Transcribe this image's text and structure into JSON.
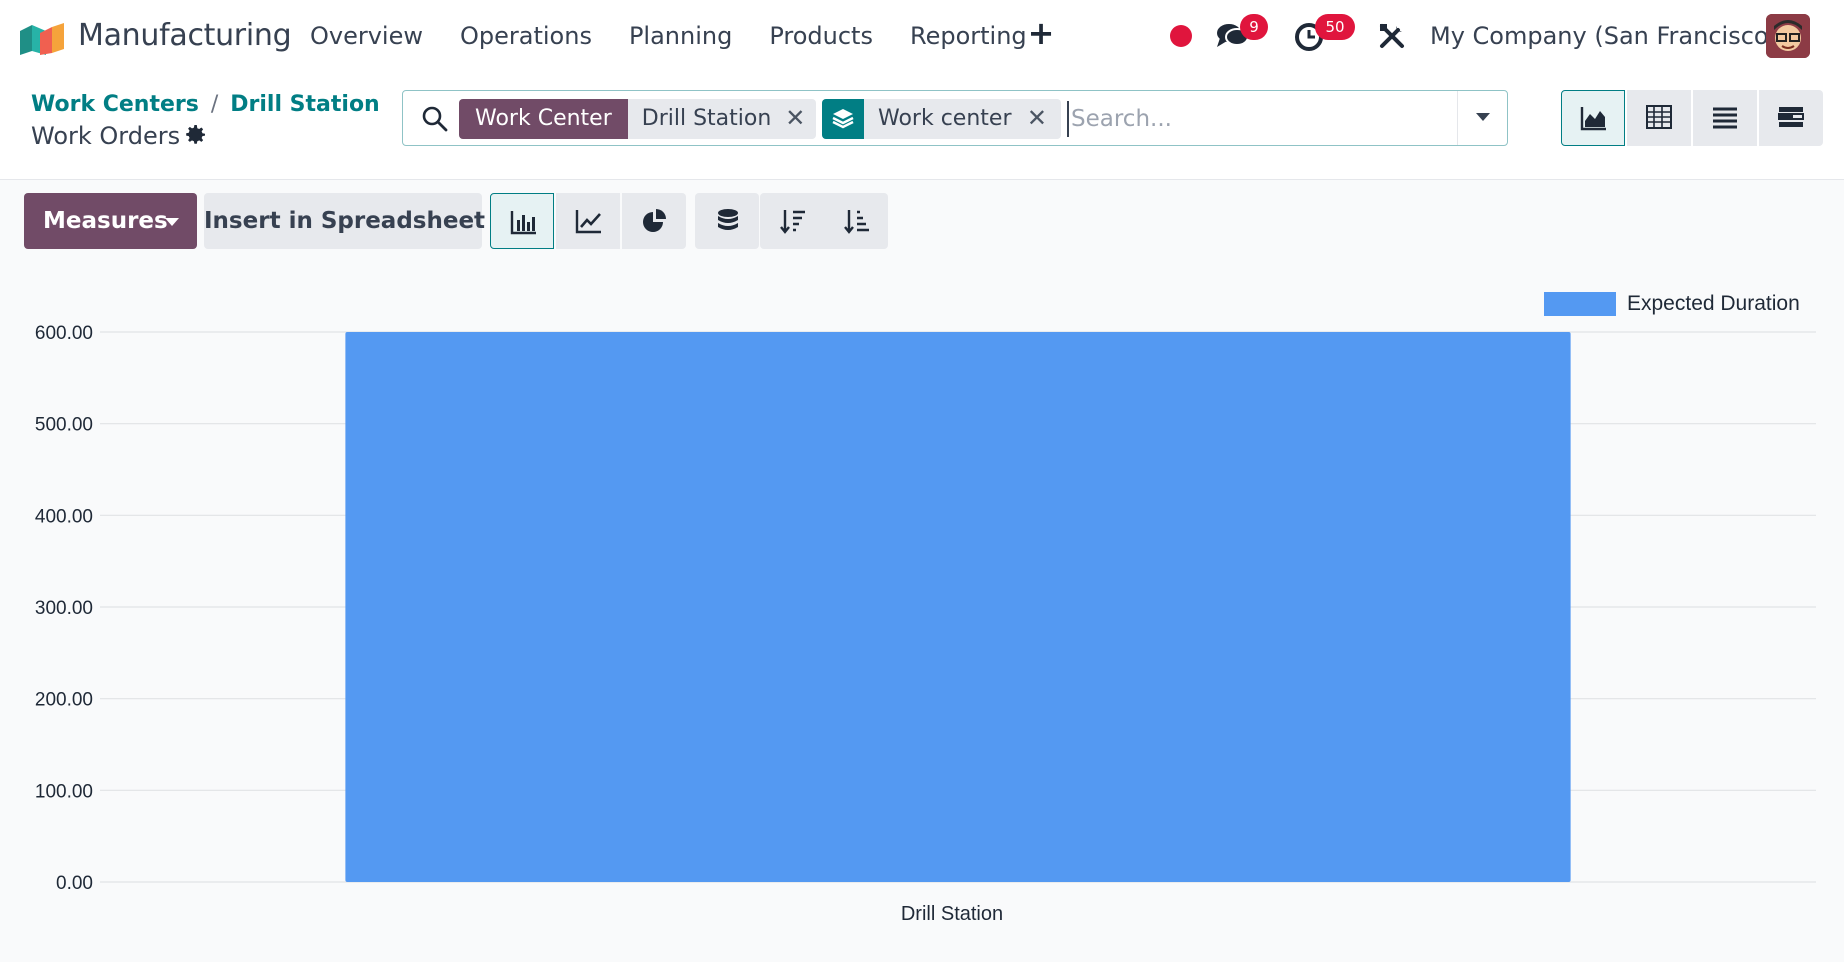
{
  "app": {
    "name": "Manufacturing"
  },
  "menu": {
    "items": [
      {
        "label": "Overview"
      },
      {
        "label": "Operations"
      },
      {
        "label": "Planning"
      },
      {
        "label": "Products"
      },
      {
        "label": "Reporting"
      }
    ]
  },
  "systray": {
    "messages_count": "9",
    "activities_count": "50",
    "company": "My Company (San Francisco)"
  },
  "breadcrumb": {
    "items": [
      {
        "label": "Work Centers"
      },
      {
        "label": "Drill Station"
      }
    ],
    "separator": "/",
    "current": "Work Orders"
  },
  "search": {
    "facets": [
      {
        "label": "Work Center",
        "value": "Drill Station",
        "kind": "filter"
      },
      {
        "label": "",
        "value": "Work center",
        "kind": "group-by",
        "icon": "layers-icon"
      }
    ],
    "placeholder": "Search...",
    "value": ""
  },
  "views": {
    "active": "graph",
    "items": [
      {
        "name": "graph",
        "icon": "area-chart-icon"
      },
      {
        "name": "pivot",
        "icon": "table-icon"
      },
      {
        "name": "list",
        "icon": "list-icon"
      },
      {
        "name": "gantt",
        "icon": "gantt-icon"
      }
    ]
  },
  "toolbar": {
    "measures_label": "Measures",
    "spreadsheet_label": "Insert in Spreadsheet",
    "modes": [
      {
        "name": "bar",
        "icon": "bar-chart-icon",
        "active": true
      },
      {
        "name": "line",
        "icon": "line-chart-icon",
        "active": false
      },
      {
        "name": "pie",
        "icon": "pie-chart-icon",
        "active": false
      }
    ],
    "extra": [
      {
        "name": "stacked",
        "icon": "database-icon"
      },
      {
        "name": "descending",
        "icon": "sort-desc-icon"
      },
      {
        "name": "ascending",
        "icon": "sort-asc-icon"
      }
    ]
  },
  "colors": {
    "brand": "#714b67",
    "accent": "#017e84",
    "bar": "#5499f2",
    "badge": "#e0153d"
  },
  "chart_data": {
    "type": "bar",
    "categories": [
      "Drill Station"
    ],
    "series": [
      {
        "name": "Expected Duration",
        "values": [
          600
        ],
        "color": "#5499f2"
      }
    ],
    "ylim": [
      0,
      600
    ],
    "yticks": [
      "0.00",
      "100.00",
      "200.00",
      "300.00",
      "400.00",
      "500.00",
      "600.00"
    ],
    "grid": true,
    "legend": "top-right"
  }
}
